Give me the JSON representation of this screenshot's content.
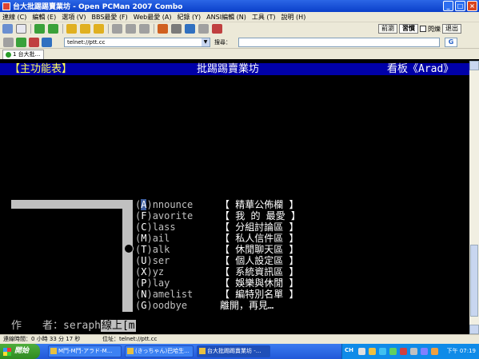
{
  "window": {
    "title": "台大批踢踢賣業坊 - Open PCMan 2007 Combo"
  },
  "menu": [
    "連線 (C)",
    "編輯 (E)",
    "選項 (V)",
    "BBS最愛 (F)",
    "Web最愛 (A)",
    "紀錄 (Y)",
    "ANSI編輯 (N)",
    "工具 (T)",
    "說明 (H)"
  ],
  "toolbar": {
    "buttons": [
      "新增",
      "開啟",
      "返回",
      "前進",
      "連線",
      "中斷",
      "複製",
      "貼上",
      "字型",
      "設定",
      "全螢幕",
      "關閉"
    ],
    "right_buttons": {
      "mode1": "前瀏",
      "mode2": "習慣",
      "check_label": "閃爍",
      "exit": "退出"
    }
  },
  "address": {
    "value": "telnet://ptt.cc",
    "search_label": "搜尋：",
    "search_value": "",
    "search_engine": "G"
  },
  "tabs": [
    {
      "label": "1 台大批..."
    }
  ],
  "terminal": {
    "header": {
      "left": "【主功能表】",
      "middle": "批踢踢賣業坊",
      "right": "看板《Arad》"
    },
    "menu_items": [
      {
        "key": "A",
        "rest": "nnounce",
        "desc": "【 精華公佈欄 】",
        "highlight": true
      },
      {
        "key": "F",
        "rest": "avorite",
        "desc": "【 我 的 最愛 】"
      },
      {
        "key": "C",
        "rest": "lass",
        "desc": "【 分組討論區 】"
      },
      {
        "key": "M",
        "rest": "ail",
        "desc": "【 私人信件區 】"
      },
      {
        "key": "T",
        "rest": "alk",
        "desc": "【 休閒聊天區 】"
      },
      {
        "key": "U",
        "rest": "ser",
        "desc": "【 個人設定區 】"
      },
      {
        "key": "X",
        "rest": "yz",
        "desc": "【 系統資訊區 】"
      },
      {
        "key": "P",
        "rest": "lay",
        "desc": "【 娛樂與休閒 】"
      },
      {
        "key": "N",
        "rest": "amelist",
        "desc": "【 編特別名單 】"
      },
      {
        "key": "G",
        "rest": "oodbye",
        "desc": "離開，再見…"
      }
    ],
    "bottom": {
      "label": "作　　者：",
      "value": "seraph",
      "tail": "線上[m"
    }
  },
  "status": {
    "connected_time": "連線時間：0 小時 33 分 17 秒",
    "location": "位址：telnet://ptt.cc"
  },
  "taskbar": {
    "start": "開始",
    "tasks": [
      {
        "label": "M鬥-M鬥-アラド-M..."
      },
      {
        "label": "(きっちゃん)巴哈生..."
      },
      {
        "label": "台大批踢踢賣業坊 -..."
      }
    ],
    "lang": "CH",
    "clock": "下午 07:19"
  },
  "colors": {
    "header_bg": "#0000a8",
    "header_left": "#ffff55",
    "terminal_bg": "#000000",
    "terminal_fg": "#c0c0c0",
    "highlight_key_bg": "#3c5c9c"
  }
}
